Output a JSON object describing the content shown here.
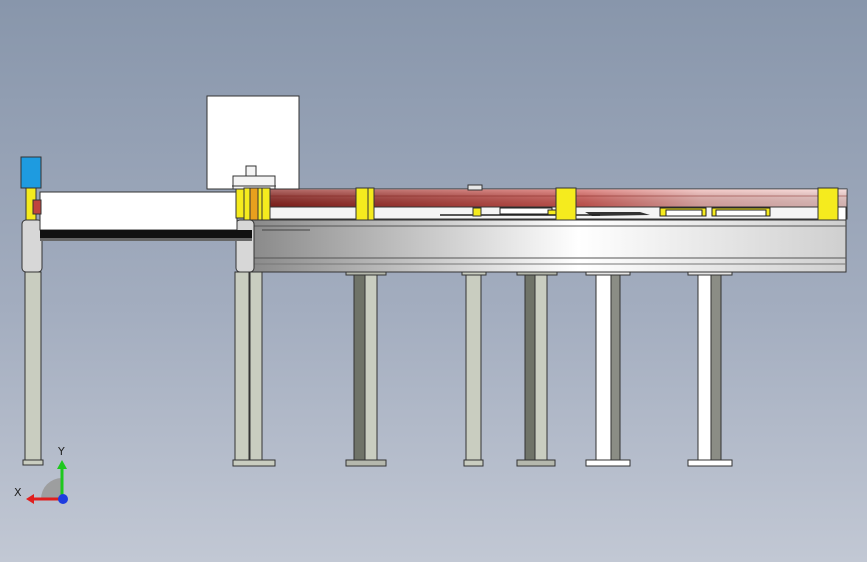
{
  "viewport": {
    "title": "",
    "background_top": "#8896ab",
    "background_bottom": "#c2c8d4"
  },
  "triad": {
    "x_label": "X",
    "y_label": "Y",
    "x_color": "#e01e1e",
    "y_color": "#1ec81e",
    "z_color": "#1e3ce0"
  },
  "colors": {
    "frame": "#ffffff",
    "leg": "#c9cdc0",
    "leg_dark": "#6f7368",
    "rail_red": "#c0443e",
    "bracket_yellow": "#f5eb1e",
    "sensor_blue": "#1e9be0",
    "beam_grey": "#d8d8d8"
  },
  "model": {
    "name_icon": "conveyor-assembly-icon",
    "components": [
      "motor-box",
      "sensor-block",
      "short-conveyor",
      "long-conveyor",
      "red-rail",
      "support-legs"
    ]
  }
}
